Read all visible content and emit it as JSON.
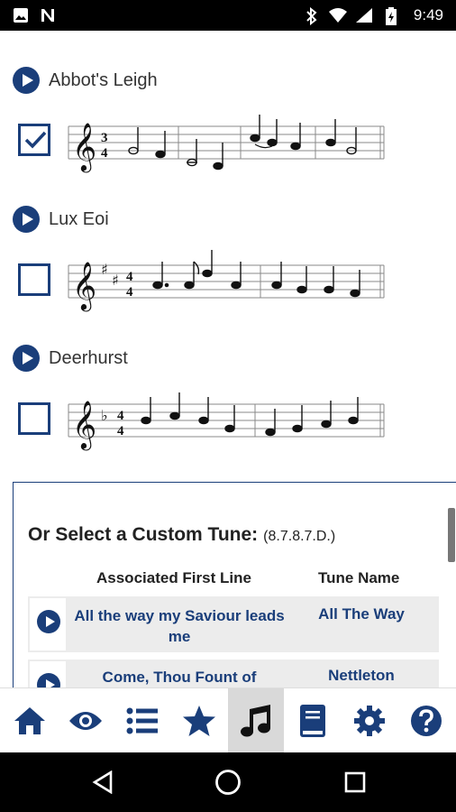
{
  "status_bar": {
    "time": "9:49"
  },
  "tunes": [
    {
      "name": "Abbot's Leigh",
      "checked": true
    },
    {
      "name": "Lux Eoi",
      "checked": false
    },
    {
      "name": "Deerhurst",
      "checked": false
    }
  ],
  "custom_tune": {
    "title": "Or Select a Custom Tune:",
    "meter": "(8.7.8.7.D.)",
    "columns": {
      "first_line": "Associated First Line",
      "tune_name": "Tune Name"
    },
    "rows": [
      {
        "first_line": "All the way my Saviour leads me",
        "tune_name": "All The Way"
      },
      {
        "first_line": "Come, Thou Fount of",
        "tune_name": "Nettleton"
      }
    ]
  },
  "nav": [
    {
      "icon": "home-icon"
    },
    {
      "icon": "eye-icon"
    },
    {
      "icon": "list-icon"
    },
    {
      "icon": "star-icon"
    },
    {
      "icon": "music-note-icon",
      "active": true
    },
    {
      "icon": "book-icon"
    },
    {
      "icon": "gear-icon"
    },
    {
      "icon": "help-icon"
    }
  ],
  "colors": {
    "accent": "#1a3e7a",
    "active_tab_bg": "#d9d9d9"
  }
}
